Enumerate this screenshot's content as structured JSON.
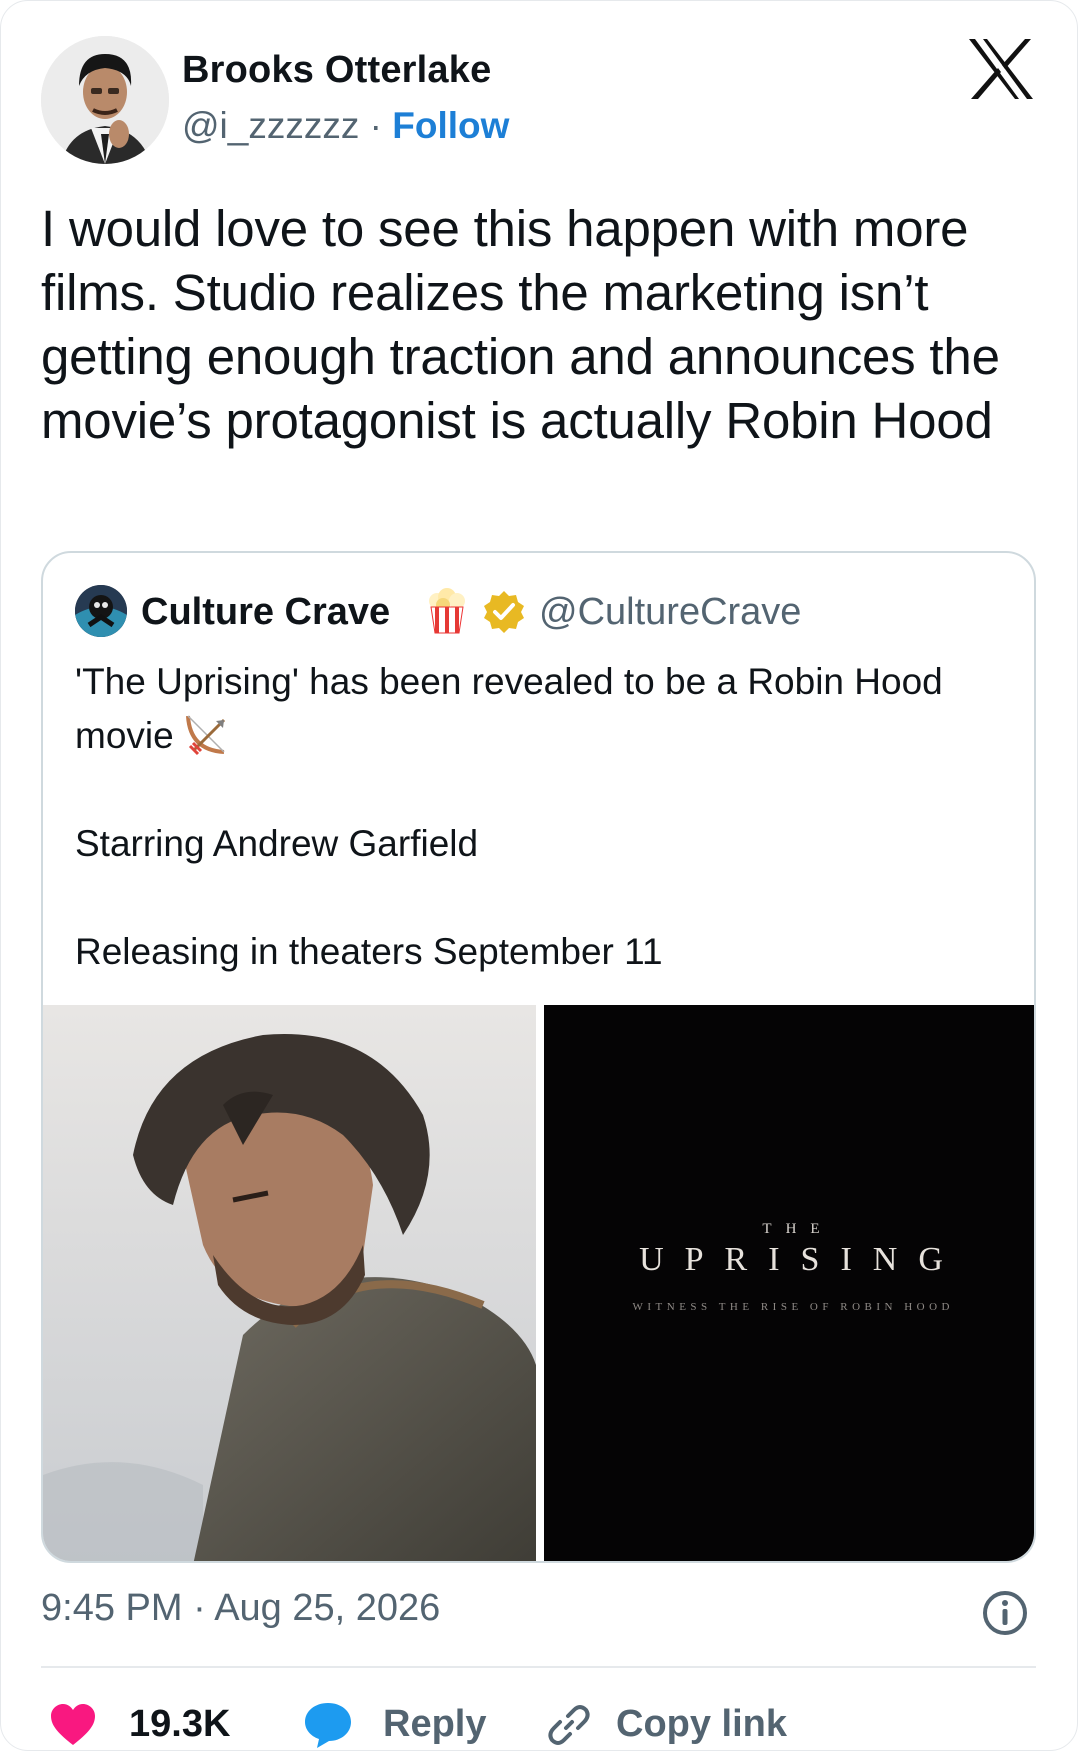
{
  "author": {
    "name": "Brooks Otterlake",
    "handle": "@i_zzzzzz",
    "separator": "·",
    "follow_label": "Follow"
  },
  "brand_icon": "x-logo-icon",
  "tweet": {
    "text": "I would love to see this happen with more films. Studio realizes the marketing isn’t getting enough traction and announces the movie’s protagonist is actually Robin Hood"
  },
  "quoted_tweet": {
    "name": "Culture Crave",
    "handle": "@CultureCrave",
    "badges": [
      "popcorn-emoji-icon",
      "verified-badge-icon"
    ],
    "line1": "'The Uprising' has been revealed to be a Robin Hood movie",
    "line1_emoji": "bow-and-arrow-icon",
    "line2": "Starring Andrew Garfield",
    "line3": "Releasing in theaters September 11",
    "media": {
      "poster_the": "THE",
      "poster_title": "UPRISING",
      "poster_tagline": "WITNESS THE RISE OF ROBIN HOOD"
    }
  },
  "timestamp": "9:45 PM · Aug 25, 2026",
  "actions": {
    "likes": "19.3K",
    "reply": "Reply",
    "copy_link": "Copy link"
  },
  "colors": {
    "accent": "#1d7fd6",
    "like": "#f91880",
    "reply_bubble": "#1d9bf0",
    "text": "#0f1419",
    "muted": "#536471",
    "verified": "#e8b923"
  }
}
